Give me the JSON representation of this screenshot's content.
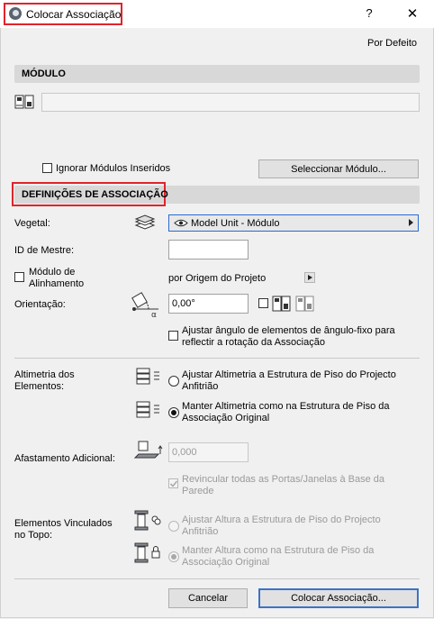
{
  "window": {
    "title": "Colocar Associação",
    "help": "?",
    "close": "✕"
  },
  "header": {
    "por_defeito": "Por Defeito"
  },
  "modulo": {
    "section_title": "MÓDULO",
    "ignorar_label": "Ignorar Módulos Inseridos",
    "ignorar_checked": false,
    "seleccionar_button": "Seleccionar Módulo..."
  },
  "definicoes": {
    "section_title": "DEFINIÇÕES DE ASSOCIAÇÃO",
    "vegetal_label": "Vegetal:",
    "vegetal_value": "Model Unit - Módulo",
    "id_mestre_label": "ID de Mestre:",
    "id_mestre_value": "",
    "modulo_alinhamento_label_1": "Módulo de",
    "modulo_alinhamento_label_2": "Alinhamento",
    "modulo_alinhamento_checked": false,
    "origem_text": "por Origem do Projeto",
    "orientacao_label": "Orientação:",
    "orientacao_value": "0,00°",
    "ajustar_angulo_line1": "Ajustar ângulo de elementos de ângulo-fixo para",
    "ajustar_angulo_line2": "reflectir a rotação da Associação",
    "ajustar_angulo_checked": false
  },
  "altimetria": {
    "label_1": "Altimetria dos",
    "label_2": "Elementos:",
    "opt1_line1": "Ajustar Altimetria a Estrutura de Piso do Projecto",
    "opt1_line2": "Anfitrião",
    "opt2_line1": "Manter Altimetria como na Estrutura de Piso da",
    "opt2_line2": "Associação Original",
    "selected": 2
  },
  "afastamento": {
    "label": "Afastamento Adicional:",
    "value": "0,000",
    "revincular_line1": "Revincular todas as Portas/Janelas à Base da",
    "revincular_line2": "Parede",
    "revincular_checked": true
  },
  "topo": {
    "label_1": "Elementos Vinculados",
    "label_2": "no Topo:",
    "opt1_line1": "Ajustar Altura a Estrutura de Piso do Projecto",
    "opt1_line2": "Anfitrião",
    "opt2_line1": "Manter Altura como na Estrutura de Piso da",
    "opt2_line2": "Associação Original",
    "selected": 2
  },
  "footer": {
    "cancel": "Cancelar",
    "ok": "Colocar Associação..."
  },
  "colors": {
    "highlight": "#e0242b",
    "focus": "#3b73c8"
  }
}
